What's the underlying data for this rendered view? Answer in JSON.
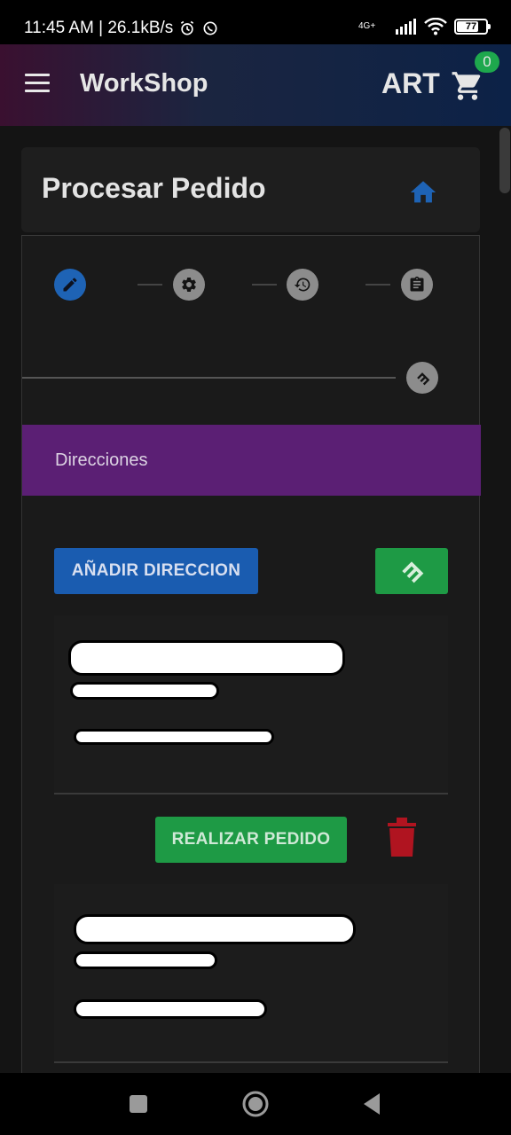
{
  "status_bar": {
    "time_speed": "11:45 AM | 26.1kB/s",
    "network": "4G+",
    "battery": "77"
  },
  "app_bar": {
    "title": "WorkShop",
    "brand": "ART",
    "cart_count": "0"
  },
  "header": {
    "title": "Procesar Pedido"
  },
  "stepper": {
    "steps": [
      {
        "icon": "edit-icon",
        "active": true
      },
      {
        "icon": "settings-icon",
        "active": false
      },
      {
        "icon": "history-icon",
        "active": false
      },
      {
        "icon": "clipboard-icon",
        "active": false
      },
      {
        "icon": "handshake-icon",
        "active": false
      }
    ]
  },
  "section": {
    "label": "Direcciones"
  },
  "actions": {
    "add_address_label": "AÑADIR DIRECCION",
    "confirm_icon": "handshake-icon",
    "place_order_label": "REALIZAR PEDIDO",
    "delete_icon": "trash-icon"
  },
  "colors": {
    "accent_blue": "#1a5cb0",
    "accent_green": "#1e9a45",
    "section_purple": "#5b1f74",
    "delete_red": "#b01420"
  }
}
